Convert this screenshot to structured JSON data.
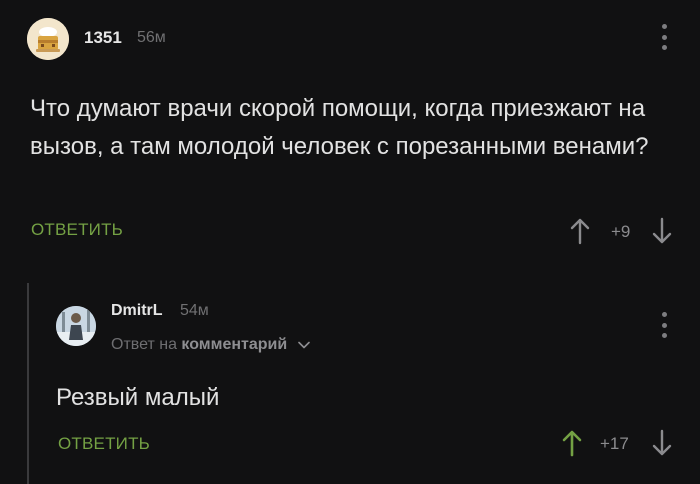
{
  "comment": {
    "author": "1351",
    "time": "56м",
    "text": "Что думают врачи скорой помощи, когда приезжают на вызов, а там молодой человек с порезанными венами?",
    "reply_label": "ОТВЕТИТЬ",
    "score": "+9",
    "avatar_icon": "cake-icon"
  },
  "reply": {
    "author": "DmitrL",
    "time": "54м",
    "reply_to_prefix": "Ответ на",
    "reply_to_link": "комментарий",
    "text": "Резвый малый",
    "reply_label": "ОТВЕТИТЬ",
    "score": "+17",
    "upvoted": true,
    "avatar_icon": "person-photo-icon"
  },
  "colors": {
    "background": "#111112",
    "accent_green": "#74a144",
    "muted": "#707072"
  }
}
